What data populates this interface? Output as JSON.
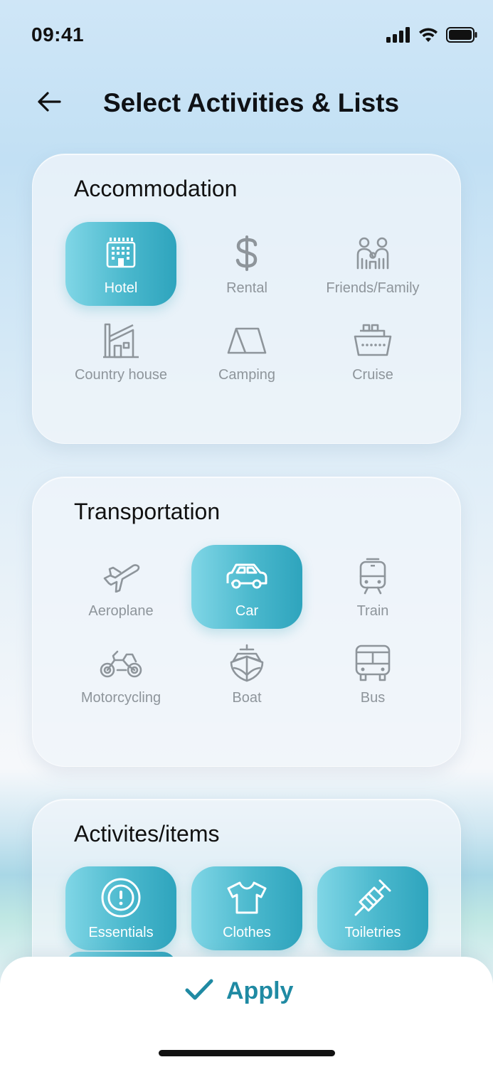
{
  "status": {
    "time": "09:41"
  },
  "header": {
    "title": "Select Activities & Lists"
  },
  "sections": {
    "accommodation": {
      "title": "Accommodation",
      "items": [
        {
          "label": "Hotel",
          "icon": "hotel-icon",
          "selected": true
        },
        {
          "label": "Rental",
          "icon": "dollar-icon",
          "selected": false
        },
        {
          "label": "Friends/Family",
          "icon": "people-icon",
          "selected": false
        },
        {
          "label": "Country house",
          "icon": "house-icon",
          "selected": false
        },
        {
          "label": "Camping",
          "icon": "tent-icon",
          "selected": false
        },
        {
          "label": "Cruise",
          "icon": "ship-icon",
          "selected": false
        }
      ]
    },
    "transportation": {
      "title": "Transportation",
      "items": [
        {
          "label": "Aeroplane",
          "icon": "plane-icon",
          "selected": false
        },
        {
          "label": "Car",
          "icon": "car-icon",
          "selected": true
        },
        {
          "label": "Train",
          "icon": "train-icon",
          "selected": false
        },
        {
          "label": "Motorcycling",
          "icon": "motorcycle-icon",
          "selected": false
        },
        {
          "label": "Boat",
          "icon": "boat-icon",
          "selected": false
        },
        {
          "label": "Bus",
          "icon": "bus-icon",
          "selected": false
        }
      ]
    },
    "activities": {
      "title": "Activites/items",
      "items": [
        {
          "label": "Essentials",
          "icon": "alert-circle-icon",
          "selected": true
        },
        {
          "label": "Clothes",
          "icon": "tshirt-icon",
          "selected": true
        },
        {
          "label": "Toiletries",
          "icon": "razor-icon",
          "selected": true
        }
      ]
    }
  },
  "footer": {
    "apply_label": "Apply"
  },
  "colors": {
    "accent": "#2ea4bd",
    "accent_light": "#80d6e6",
    "apply_text": "#1f8aa3",
    "muted": "#8e959b"
  }
}
